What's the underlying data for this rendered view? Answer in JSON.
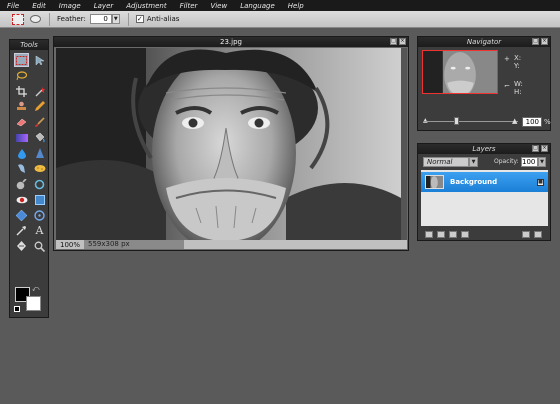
{
  "menu": [
    "File",
    "Edit",
    "Image",
    "Layer",
    "Adjustment",
    "Filter",
    "View",
    "Language",
    "Help"
  ],
  "options": {
    "feather_label": "Feather:",
    "feather_value": "0",
    "antialias_label": "Anti-alias",
    "antialias_checked": true
  },
  "tools_panel": {
    "title": "Tools"
  },
  "image_window": {
    "title": "23.jpg",
    "zoom": "100",
    "zoom_unit": "%",
    "dimensions": "559x308 px"
  },
  "navigator": {
    "title": "Navigator",
    "x_label": "X:",
    "y_label": "Y:",
    "w_label": "W:",
    "h_label": "H:",
    "zoom": "100",
    "zoom_unit": "%"
  },
  "layers_panel": {
    "title": "Layers",
    "blend_mode": "Normal",
    "opacity_label": "Opacity:",
    "opacity": "100",
    "layers": [
      {
        "name": "Background",
        "selected": true
      }
    ]
  },
  "colors": {
    "foreground": "#000000",
    "background": "#ffffff",
    "layer_selected": "#2a8fe6"
  }
}
